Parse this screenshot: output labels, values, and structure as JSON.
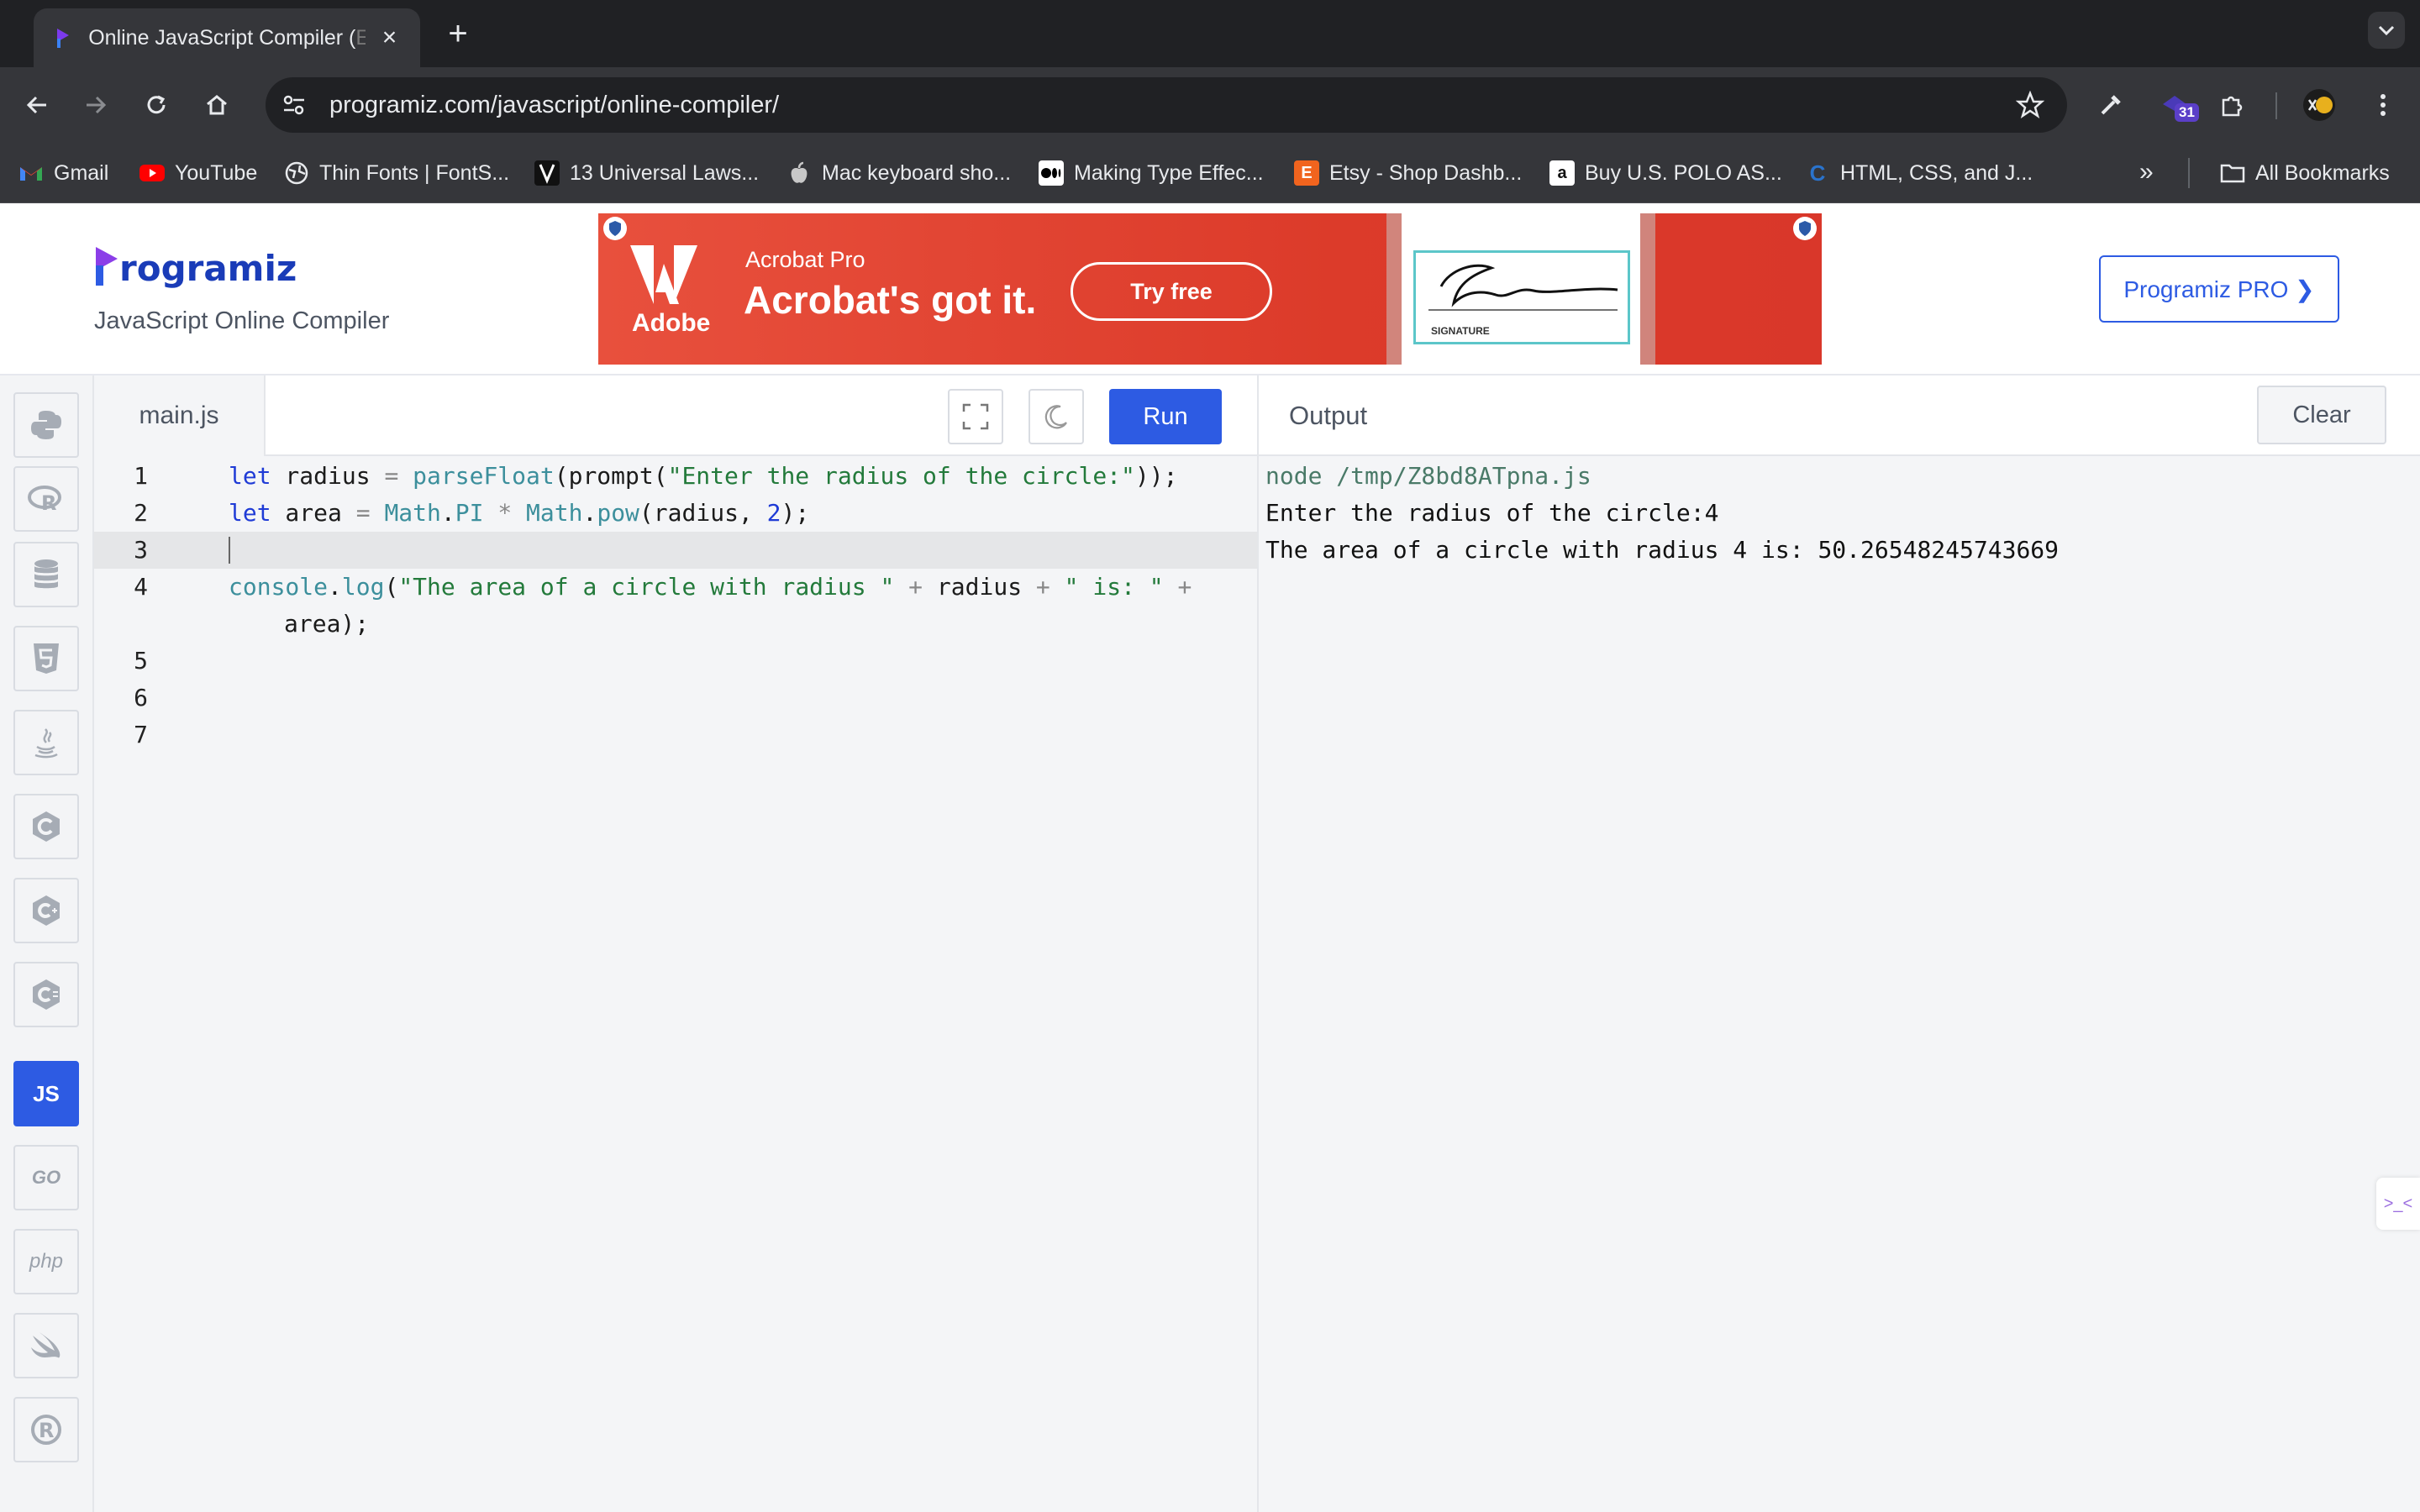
{
  "browser": {
    "tab": {
      "title": "Online JavaScript Compiler (",
      "title_fade": "E",
      "close": "×"
    },
    "new_tab": "+",
    "url": "programiz.com/javascript/online-compiler/",
    "extension_badge": "31",
    "bookmarks": [
      {
        "label": "Gmail",
        "icon": "gmail-icon"
      },
      {
        "label": "YouTube",
        "icon": "youtube-icon"
      },
      {
        "label": "Thin Fonts | FontS...",
        "icon": "globe-icon"
      },
      {
        "label": "13 Universal Laws...",
        "icon": "bookmark-site-icon"
      },
      {
        "label": "Mac keyboard sho...",
        "icon": "apple-icon"
      },
      {
        "label": "Making Type Effec...",
        "icon": "medium-icon"
      },
      {
        "label": "Etsy - Shop Dashb...",
        "icon": "etsy-icon"
      },
      {
        "label": "Buy U.S. POLO AS...",
        "icon": "amazon-icon"
      },
      {
        "label": "HTML, CSS, and J...",
        "icon": "coursera-icon"
      }
    ],
    "more_bookmarks": "»",
    "all_bookmarks": "All Bookmarks"
  },
  "site": {
    "brand": "rogramiz",
    "subtitle": "JavaScript Online Compiler",
    "pro_button": "Programiz PRO ❯"
  },
  "ad": {
    "brand": "Adobe",
    "product": "Acrobat Pro",
    "headline": "Acrobat's got it.",
    "cta": "Try free",
    "signature_label": "SIGNATURE",
    "colors": {
      "background": "#e0412f",
      "accent": "#5cc6c9"
    }
  },
  "sidebar": {
    "languages": [
      {
        "name": "python",
        "icon": "python-icon"
      },
      {
        "name": "r",
        "icon": "r-icon"
      },
      {
        "name": "sql",
        "icon": "database-icon"
      },
      {
        "name": "html",
        "icon": "html5-icon"
      },
      {
        "name": "java",
        "icon": "java-icon"
      },
      {
        "name": "c",
        "icon": "c-icon"
      },
      {
        "name": "cpp",
        "icon": "cpp-icon"
      },
      {
        "name": "csharp",
        "icon": "csharp-icon"
      },
      {
        "name": "javascript",
        "label": "JS",
        "active": true
      },
      {
        "name": "go",
        "label": "GO"
      },
      {
        "name": "php",
        "label": "php"
      },
      {
        "name": "swift",
        "icon": "swift-icon"
      },
      {
        "name": "rust",
        "icon": "rust-icon"
      }
    ]
  },
  "editor": {
    "filename": "main.js",
    "run_label": "Run",
    "line_numbers": [
      "1",
      "2",
      "3",
      "4",
      "5",
      "6",
      "7"
    ],
    "code": {
      "l1": {
        "kw": "let",
        "a": " radius ",
        "eq": "=",
        "fn1": " parseFloat",
        "b": "(prompt(",
        "str": "\"Enter the radius of the circle:\"",
        "c": "));"
      },
      "l2": {
        "kw": "let",
        "a": " area ",
        "eq": "=",
        "fn1": " Math",
        "b": ".",
        "fn2": "PI",
        "op": " * ",
        "fn3": "Math",
        "c": ".",
        "fn4": "pow",
        "d": "(radius, ",
        "num": "2",
        "e": ");"
      },
      "l4": {
        "fn1": "console",
        "a": ".",
        "fn2": "log",
        "b": "(",
        "str1": "\"The area of a circle with radius \"",
        "op1": " + ",
        "c": "radius",
        "op2": " + ",
        "str2": "\" is: \"",
        "op3": " +"
      },
      "l4_wrap": "area);"
    }
  },
  "output": {
    "title": "Output",
    "clear_label": "Clear",
    "lines": [
      "node /tmp/Z8bd8ATpna.js",
      "Enter the radius of the circle:4",
      "The area of a circle with radius 4 is: 50.26548245743669"
    ],
    "help_tab": ">_<"
  }
}
